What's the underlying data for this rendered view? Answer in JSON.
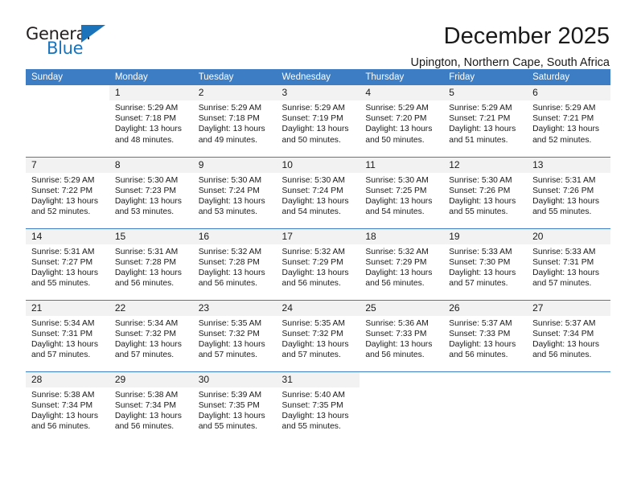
{
  "logo": {
    "word_one": "General",
    "word_two": "Blue",
    "triangle_icon": "blue-triangle-icon"
  },
  "header": {
    "title": "December 2025",
    "subtitle": "Upington, Northern Cape, South Africa"
  },
  "colors": {
    "header_blue": "#3c7dc4",
    "logo_blue": "#1b74bb",
    "daynum_band": "#f2f2f2",
    "text": "#1a1a1a"
  },
  "calendar": {
    "weekday_headers": [
      "Sunday",
      "Monday",
      "Tuesday",
      "Wednesday",
      "Thursday",
      "Friday",
      "Saturday"
    ],
    "weeks": [
      [
        {
          "blank": true
        },
        {
          "day": "1",
          "sunrise": "Sunrise: 5:29 AM",
          "sunset": "Sunset: 7:18 PM",
          "daylight": "Daylight: 13 hours and 48 minutes."
        },
        {
          "day": "2",
          "sunrise": "Sunrise: 5:29 AM",
          "sunset": "Sunset: 7:18 PM",
          "daylight": "Daylight: 13 hours and 49 minutes."
        },
        {
          "day": "3",
          "sunrise": "Sunrise: 5:29 AM",
          "sunset": "Sunset: 7:19 PM",
          "daylight": "Daylight: 13 hours and 50 minutes."
        },
        {
          "day": "4",
          "sunrise": "Sunrise: 5:29 AM",
          "sunset": "Sunset: 7:20 PM",
          "daylight": "Daylight: 13 hours and 50 minutes."
        },
        {
          "day": "5",
          "sunrise": "Sunrise: 5:29 AM",
          "sunset": "Sunset: 7:21 PM",
          "daylight": "Daylight: 13 hours and 51 minutes."
        },
        {
          "day": "6",
          "sunrise": "Sunrise: 5:29 AM",
          "sunset": "Sunset: 7:21 PM",
          "daylight": "Daylight: 13 hours and 52 minutes."
        }
      ],
      [
        {
          "day": "7",
          "sunrise": "Sunrise: 5:29 AM",
          "sunset": "Sunset: 7:22 PM",
          "daylight": "Daylight: 13 hours and 52 minutes."
        },
        {
          "day": "8",
          "sunrise": "Sunrise: 5:30 AM",
          "sunset": "Sunset: 7:23 PM",
          "daylight": "Daylight: 13 hours and 53 minutes."
        },
        {
          "day": "9",
          "sunrise": "Sunrise: 5:30 AM",
          "sunset": "Sunset: 7:24 PM",
          "daylight": "Daylight: 13 hours and 53 minutes."
        },
        {
          "day": "10",
          "sunrise": "Sunrise: 5:30 AM",
          "sunset": "Sunset: 7:24 PM",
          "daylight": "Daylight: 13 hours and 54 minutes."
        },
        {
          "day": "11",
          "sunrise": "Sunrise: 5:30 AM",
          "sunset": "Sunset: 7:25 PM",
          "daylight": "Daylight: 13 hours and 54 minutes."
        },
        {
          "day": "12",
          "sunrise": "Sunrise: 5:30 AM",
          "sunset": "Sunset: 7:26 PM",
          "daylight": "Daylight: 13 hours and 55 minutes."
        },
        {
          "day": "13",
          "sunrise": "Sunrise: 5:31 AM",
          "sunset": "Sunset: 7:26 PM",
          "daylight": "Daylight: 13 hours and 55 minutes."
        }
      ],
      [
        {
          "day": "14",
          "sunrise": "Sunrise: 5:31 AM",
          "sunset": "Sunset: 7:27 PM",
          "daylight": "Daylight: 13 hours and 55 minutes."
        },
        {
          "day": "15",
          "sunrise": "Sunrise: 5:31 AM",
          "sunset": "Sunset: 7:28 PM",
          "daylight": "Daylight: 13 hours and 56 minutes."
        },
        {
          "day": "16",
          "sunrise": "Sunrise: 5:32 AM",
          "sunset": "Sunset: 7:28 PM",
          "daylight": "Daylight: 13 hours and 56 minutes."
        },
        {
          "day": "17",
          "sunrise": "Sunrise: 5:32 AM",
          "sunset": "Sunset: 7:29 PM",
          "daylight": "Daylight: 13 hours and 56 minutes."
        },
        {
          "day": "18",
          "sunrise": "Sunrise: 5:32 AM",
          "sunset": "Sunset: 7:29 PM",
          "daylight": "Daylight: 13 hours and 56 minutes."
        },
        {
          "day": "19",
          "sunrise": "Sunrise: 5:33 AM",
          "sunset": "Sunset: 7:30 PM",
          "daylight": "Daylight: 13 hours and 57 minutes."
        },
        {
          "day": "20",
          "sunrise": "Sunrise: 5:33 AM",
          "sunset": "Sunset: 7:31 PM",
          "daylight": "Daylight: 13 hours and 57 minutes."
        }
      ],
      [
        {
          "day": "21",
          "sunrise": "Sunrise: 5:34 AM",
          "sunset": "Sunset: 7:31 PM",
          "daylight": "Daylight: 13 hours and 57 minutes."
        },
        {
          "day": "22",
          "sunrise": "Sunrise: 5:34 AM",
          "sunset": "Sunset: 7:32 PM",
          "daylight": "Daylight: 13 hours and 57 minutes."
        },
        {
          "day": "23",
          "sunrise": "Sunrise: 5:35 AM",
          "sunset": "Sunset: 7:32 PM",
          "daylight": "Daylight: 13 hours and 57 minutes."
        },
        {
          "day": "24",
          "sunrise": "Sunrise: 5:35 AM",
          "sunset": "Sunset: 7:32 PM",
          "daylight": "Daylight: 13 hours and 57 minutes."
        },
        {
          "day": "25",
          "sunrise": "Sunrise: 5:36 AM",
          "sunset": "Sunset: 7:33 PM",
          "daylight": "Daylight: 13 hours and 56 minutes."
        },
        {
          "day": "26",
          "sunrise": "Sunrise: 5:37 AM",
          "sunset": "Sunset: 7:33 PM",
          "daylight": "Daylight: 13 hours and 56 minutes."
        },
        {
          "day": "27",
          "sunrise": "Sunrise: 5:37 AM",
          "sunset": "Sunset: 7:34 PM",
          "daylight": "Daylight: 13 hours and 56 minutes."
        }
      ],
      [
        {
          "day": "28",
          "sunrise": "Sunrise: 5:38 AM",
          "sunset": "Sunset: 7:34 PM",
          "daylight": "Daylight: 13 hours and 56 minutes."
        },
        {
          "day": "29",
          "sunrise": "Sunrise: 5:38 AM",
          "sunset": "Sunset: 7:34 PM",
          "daylight": "Daylight: 13 hours and 56 minutes."
        },
        {
          "day": "30",
          "sunrise": "Sunrise: 5:39 AM",
          "sunset": "Sunset: 7:35 PM",
          "daylight": "Daylight: 13 hours and 55 minutes."
        },
        {
          "day": "31",
          "sunrise": "Sunrise: 5:40 AM",
          "sunset": "Sunset: 7:35 PM",
          "daylight": "Daylight: 13 hours and 55 minutes."
        },
        {
          "blank": true
        },
        {
          "blank": true
        },
        {
          "blank": true
        }
      ]
    ]
  }
}
